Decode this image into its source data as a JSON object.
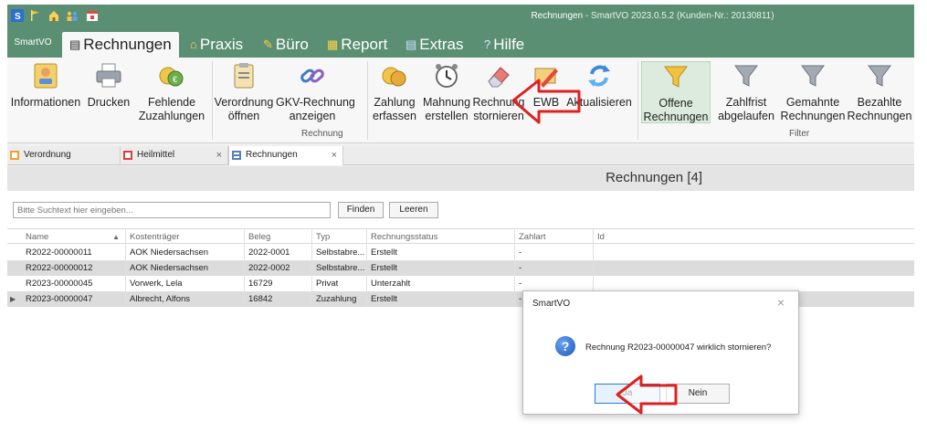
{
  "window": {
    "title_main": "Rechnungen",
    "title_rest": " - SmartVO 2023.0.5.2 (Kunden-Nr.: 20130811)"
  },
  "ribbon_tabs": {
    "app": "SmartVO",
    "items": [
      {
        "label": "Rechnungen",
        "icon": "invoice-icon"
      },
      {
        "label": "Praxis",
        "icon": "home-icon"
      },
      {
        "label": "Büro",
        "icon": "office-icon"
      },
      {
        "label": "Report",
        "icon": "report-icon"
      },
      {
        "label": "Extras",
        "icon": "extras-icon"
      },
      {
        "label": "Hilfe",
        "icon": "help-icon"
      }
    ]
  },
  "ribbon": {
    "buttons": {
      "informationen": "Informationen",
      "drucken": "Drucken",
      "fehlende_1": "Fehlende",
      "fehlende_2": "Zuzahlungen",
      "verordnung_1": "Verordnung",
      "verordnung_2": "öffnen",
      "gkv_1": "GKV-Rechnung",
      "gkv_2": "anzeigen",
      "zahlung_1": "Zahlung",
      "zahlung_2": "erfassen",
      "mahnung_1": "Mahnung",
      "mahnung_2": "erstellen",
      "rechnung_1": "Rechnung",
      "rechnung_2": "stornieren",
      "ewb": "EWB",
      "aktualisieren": "Aktualisieren",
      "offene_1": "Offene",
      "offene_2": "Rechnungen",
      "zahlfrist_1": "Zahlfrist",
      "zahlfrist_2": "abgelaufen",
      "gemahnte_1": "Gemahnte",
      "gemahnte_2": "Rechnungen",
      "bezahlte_1": "Bezahlte",
      "bezahlte_2": "Rechnungen"
    },
    "groups": {
      "rechnung": "Rechnung",
      "filter": "Filter"
    }
  },
  "doc_tabs": [
    {
      "label": "Verordnung"
    },
    {
      "label": "Heilmittel"
    },
    {
      "label": "Rechnungen"
    }
  ],
  "main": {
    "header": "Rechnungen [4]",
    "search_placeholder": "Bitte Suchtext hier eingeben...",
    "find_label": "Finden",
    "clear_label": "Leeren"
  },
  "grid": {
    "columns": [
      "Name",
      "Kostenträger",
      "Beleg",
      "Typ",
      "Rechnungsstatus",
      "Zahlart",
      "Id"
    ],
    "rows": [
      [
        "R2022-00000011",
        "AOK Niedersachsen",
        "2022-0001",
        "Selbstabre...",
        "Erstellt",
        "-",
        ""
      ],
      [
        "R2022-00000012",
        "AOK Niedersachsen",
        "2022-0002",
        "Selbstabre...",
        "Erstellt",
        "-",
        ""
      ],
      [
        "R2023-00000045",
        "Vorwerk, Lela",
        "16729",
        "Privat",
        "Unterzahlt",
        "-",
        ""
      ],
      [
        "R2023-00000047",
        "Albrecht, Alfons",
        "16842",
        "Zuzahlung",
        "Erstellt",
        "-",
        ""
      ]
    ]
  },
  "dialog": {
    "title": "SmartVO",
    "message": "Rechnung R2023-00000047 wirklich stornieren?",
    "yes_label": "Ja",
    "no_label": "Nein"
  },
  "colors": {
    "accent": "#5b8f73",
    "annotation_arrow": "#e02020"
  }
}
